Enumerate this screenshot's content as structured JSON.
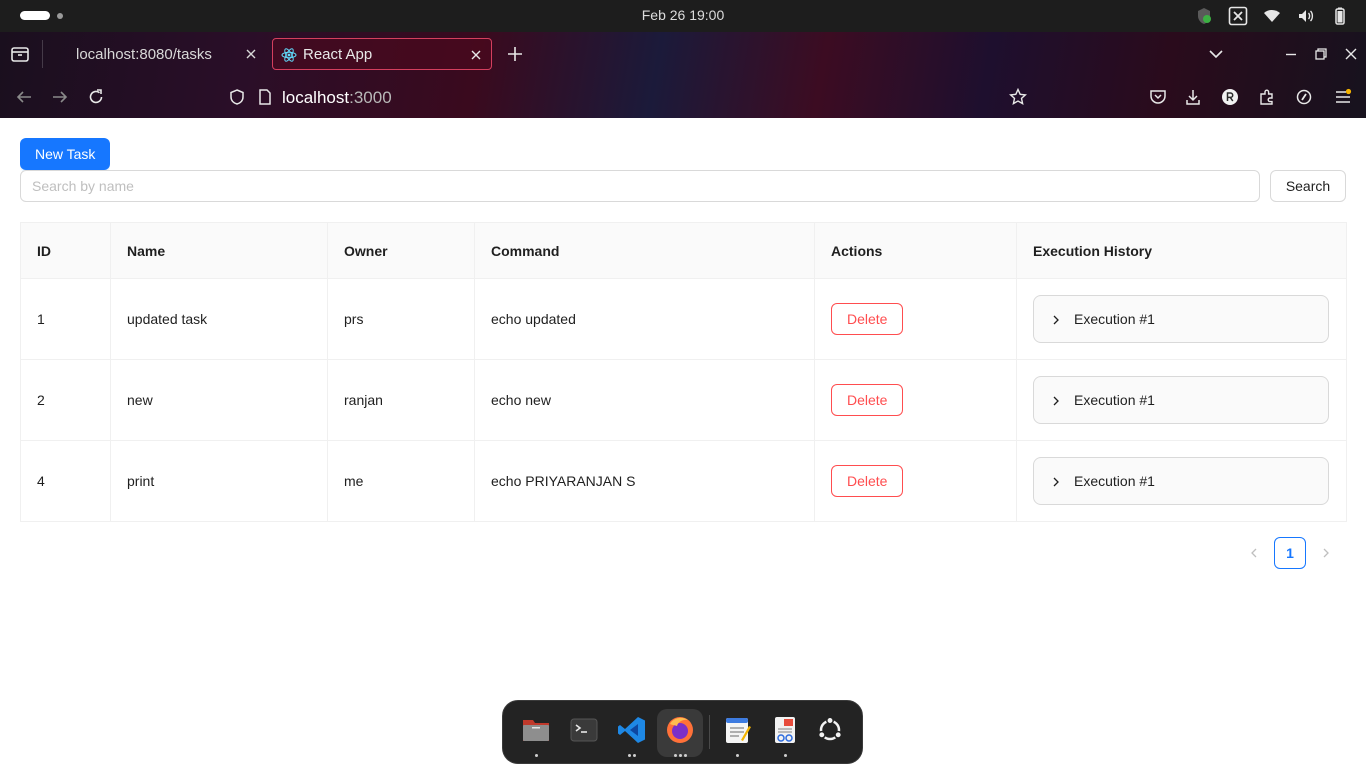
{
  "system": {
    "clock": "Feb 26  19:00"
  },
  "browser": {
    "tabs": [
      {
        "title": "localhost:8080/tasks",
        "active": false
      },
      {
        "title": "React App",
        "active": true
      }
    ],
    "url": {
      "host": "localhost",
      "port": ":3000"
    }
  },
  "page": {
    "new_task_label": "New Task",
    "search": {
      "placeholder": "Search by name",
      "value": "",
      "button_label": "Search"
    },
    "table": {
      "headers": [
        "ID",
        "Name",
        "Owner",
        "Command",
        "Actions",
        "Execution History"
      ],
      "rows": [
        {
          "id": "1",
          "name": "updated task",
          "owner": "prs",
          "command": "echo updated",
          "action": "Delete",
          "execution": "Execution #1"
        },
        {
          "id": "2",
          "name": "new",
          "owner": "ranjan",
          "command": "echo new",
          "action": "Delete",
          "execution": "Execution #1"
        },
        {
          "id": "4",
          "name": "print",
          "owner": "me",
          "command": "echo PRIYARANJAN S",
          "action": "Delete",
          "execution": "Execution #1"
        }
      ]
    },
    "pagination": {
      "current_page": "1"
    }
  },
  "dock": {
    "apps": [
      "files-icon",
      "terminal-icon",
      "vscode-icon",
      "firefox-icon",
      "text-editor-icon",
      "document-viewer-icon",
      "app-grid-icon"
    ]
  },
  "colors": {
    "primary": "#1677ff",
    "danger": "#ff4d4f",
    "active_tab_border": "#d43f5e"
  }
}
